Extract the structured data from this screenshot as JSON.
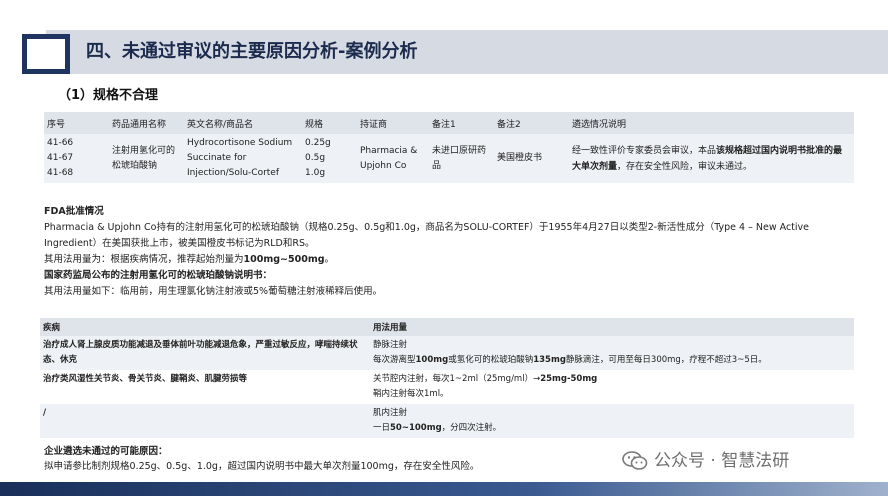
{
  "header": {
    "title": "四、未通过审议的主要原因分析-案例分析"
  },
  "section": {
    "title": "（1）规格不合理"
  },
  "table1": {
    "headers": [
      "序号",
      "药品通用名称",
      "英文名称/商品名",
      "规格",
      "持证商",
      "备注1",
      "备注2",
      "遴选情况说明"
    ],
    "row": {
      "ids": [
        "41-66",
        "41-67",
        "41-68"
      ],
      "generic_name": "注射用氢化可的松琥珀酸钠",
      "english_name": "Hydrocortisone Sodium Succinate for Injection/Solu-Cortef",
      "specs": [
        "0.25g",
        "0.5g",
        "1.0g"
      ],
      "holder": "Pharmacia & Upjohn Co",
      "note1": "未进口原研药品",
      "note2": "美国橙皮书",
      "explanation_pre": "经一致性评价专家委员会审议，本品",
      "explanation_bold": "该规格超过国内说明书批准的最大单次剂量",
      "explanation_post": "，存在安全性风险，审议未通过。"
    }
  },
  "fda": {
    "heading": "FDA批准情况",
    "para1": "Pharmacia & Upjohn Co持有的注射用氢化可的松琥珀酸钠（规格0.25g、0.5g和1.0g，商品名为SOLU-CORTEF）于1955年4月27日以类型2-新活性成分（Type 4 – New Active Ingredient）在美国获批上市，被美国橙皮书标记为RLD和RS。",
    "dose_pre": "其用法用量为：根据疾病情况，推荐起始剂量为",
    "dose_bold": "100mg~500mg",
    "dose_post": "。",
    "nmpa_heading": "国家药监局公布的注射用氢化可的松琥珀酸钠说明书：",
    "nmpa_text": "其用法用量如下：临用前，用生理氯化钠注射液或5%葡萄糖注射液稀释后使用。"
  },
  "table2": {
    "headers": [
      "疾病",
      "用法用量"
    ],
    "r1_disease": "治疗成人肾上腺皮质功能减退及垂体前叶功能减退危象，严重过敏反应，哮喘持续状态、休克",
    "r1_route": "静脉注射",
    "r1_dose_pre": "每次游离型",
    "r1_dose_b1": "100mg",
    "r1_dose_mid": "或氢化可的松琥珀酸钠",
    "r1_dose_b2": "135mg",
    "r1_dose_post": "静脉滴注，可用至每日300mg，疗程不超过3~5日。",
    "r2_disease": "治疗类风湿性关节炎、骨关节炎、腱鞘炎、肌腱劳损等",
    "r2_route_pre": "关节腔内注射，每次1~2ml（25mg/ml）→",
    "r2_route_bold": "25mg-50mg",
    "r2_route2": "鞘内注射每次1ml。",
    "r3_disease": "/",
    "r3_route": "肌内注射",
    "r3_dose_pre": "一日",
    "r3_dose_bold": "50~100mg",
    "r3_dose_post": "，分四次注射。"
  },
  "conclusion": {
    "heading": "企业遴选未通过的可能原因：",
    "text": "拟申请参比制剂规格0.25g、0.5g、1.0g，超过国内说明书中最大单次剂量100mg，存在安全性风险。"
  },
  "watermark": {
    "text": "公众号 · 智慧法研",
    "icon": "wechat-icon"
  }
}
